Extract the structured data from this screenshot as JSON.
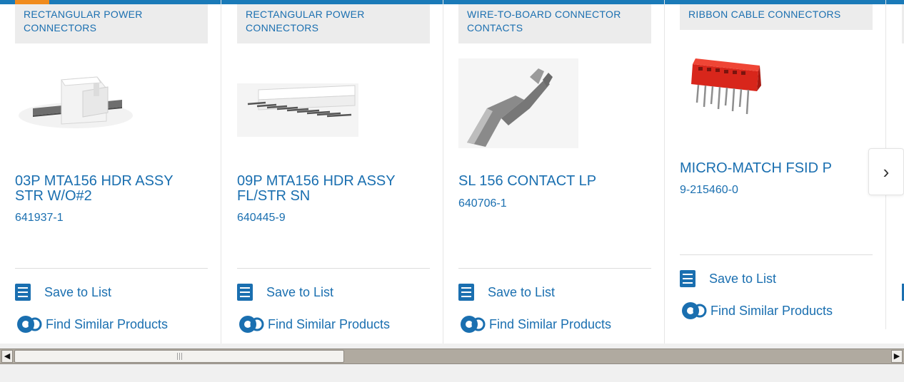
{
  "cards": [
    {
      "category": "RECTANGULAR POWER CONNECTORS",
      "title": "03P MTA156 HDR ASSY STR W/O#2",
      "part_number": "641937-1",
      "save_label": "Save to List",
      "similar_label": "Find Similar Products"
    },
    {
      "category": "RECTANGULAR POWER CONNECTORS",
      "title": "09P MTA156 HDR ASSY FL/STR SN",
      "part_number": "640445-9",
      "save_label": "Save to List",
      "similar_label": "Find Similar Products"
    },
    {
      "category": "WIRE-TO-BOARD CONNECTOR CONTACTS",
      "title": "SL 156 CONTACT LP",
      "part_number": "640706-1",
      "save_label": "Save to List",
      "similar_label": "Find Similar Products"
    },
    {
      "category": "RIBBON CABLE CONNECTORS",
      "title": "MICRO-MATCH FSID P",
      "part_number": "9-215460-0",
      "save_label": "Save to List",
      "similar_label": "Find Similar Products"
    }
  ],
  "carousel": {
    "next_icon": "chevron-right-icon",
    "next_glyph": "›"
  },
  "scrollbar": {
    "left_arrow": "◀",
    "right_arrow": "▶"
  },
  "colors": {
    "link": "#1a6fb0",
    "accent": "#f08b1d",
    "topbar": "#1a7ab8"
  }
}
